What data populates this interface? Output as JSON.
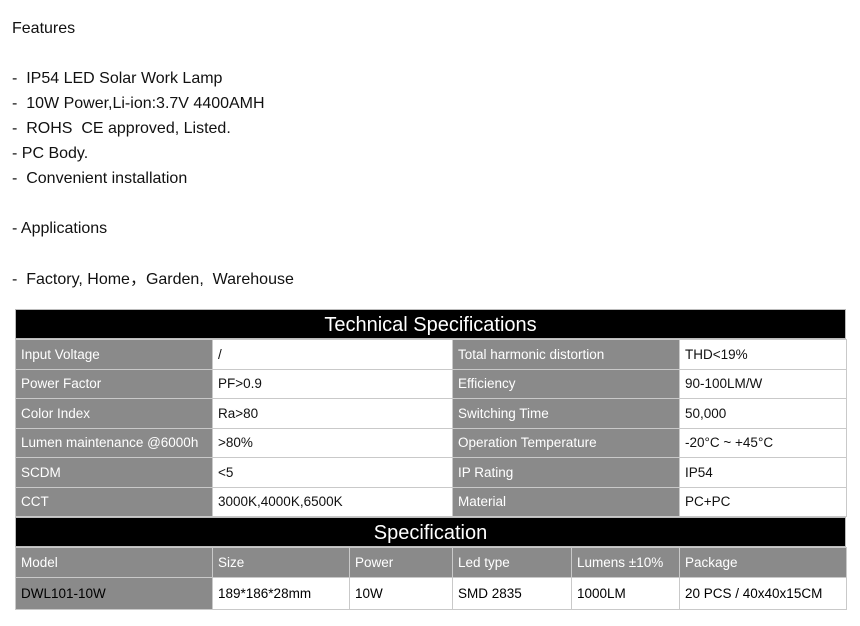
{
  "features": {
    "title": "Features",
    "items": [
      "-  IP54 LED Solar Work Lamp",
      "-  10W Power,Li-ion:3.7V 4400AMH",
      "-  ROHS  CE approved, Listed.",
      "- PC Body.",
      "-  Convenient installation"
    ]
  },
  "applications": {
    "title": "- Applications",
    "items": "-  Factory, Home，Garden,  Warehouse"
  },
  "tech_specs": {
    "title": "Technical Specifications",
    "rows": [
      {
        "k1": "Input Voltage",
        "v1": "/",
        "k2": "Total harmonic distortion",
        "v2": "THD<19%"
      },
      {
        "k1": "Power Factor",
        "v1": "PF>0.9",
        "k2": "Efficiency",
        "v2": "90-100LM/W"
      },
      {
        "k1": "Color Index",
        "v1": "Ra>80",
        "k2": "Switching Time",
        "v2": "50,000"
      },
      {
        "k1": "Lumen maintenance @6000h",
        "v1": " >80%",
        "k2": "Operation Temperature",
        "v2": "-20°C ~ +45°C"
      },
      {
        "k1": "SCDM",
        "v1": "<5",
        "k2": "IP Rating",
        "v2": "IP54"
      },
      {
        "k1": "CCT",
        "v1": "3000K,4000K,6500K",
        "k2": "Material",
        "v2": "PC+PC"
      }
    ]
  },
  "specification": {
    "title": "Specification",
    "headers": [
      "Model",
      "Size",
      "Power",
      "Led type",
      "Lumens  ±10%",
      "Package"
    ],
    "row": [
      "DWL101-10W",
      "189*186*28mm",
      "10W",
      "SMD 2835",
      "1000LM",
      "20 PCS / 40x40x15CM"
    ]
  }
}
